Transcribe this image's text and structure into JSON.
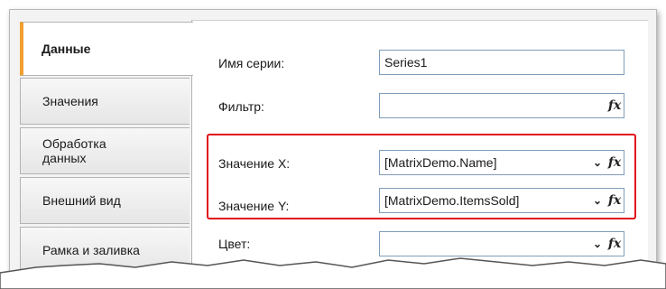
{
  "tabs": [
    {
      "label": "Данные",
      "active": true
    },
    {
      "label": "Значения",
      "active": false
    },
    {
      "label": "Обработка данных",
      "active": false
    },
    {
      "label": "Внешний вид",
      "active": false
    },
    {
      "label": "Рамка и заливка",
      "active": false
    }
  ],
  "form": {
    "series_name": {
      "label": "Имя серии:",
      "value": "Series1"
    },
    "filter": {
      "label": "Фильтр:",
      "value": ""
    },
    "value_x": {
      "label": "Значение X:",
      "value": "[MatrixDemo.Name]"
    },
    "value_y": {
      "label": "Значение Y:",
      "value": "[MatrixDemo.ItemsSold]"
    },
    "color": {
      "label": "Цвет:",
      "value": ""
    }
  },
  "icons": {
    "fx": "fx-function-icon",
    "dropdown": "chevron-down-icon"
  },
  "colors": {
    "highlight": "#e0101c",
    "active_tab_accent": "#f0a030",
    "field_border": "#7f9db9"
  }
}
